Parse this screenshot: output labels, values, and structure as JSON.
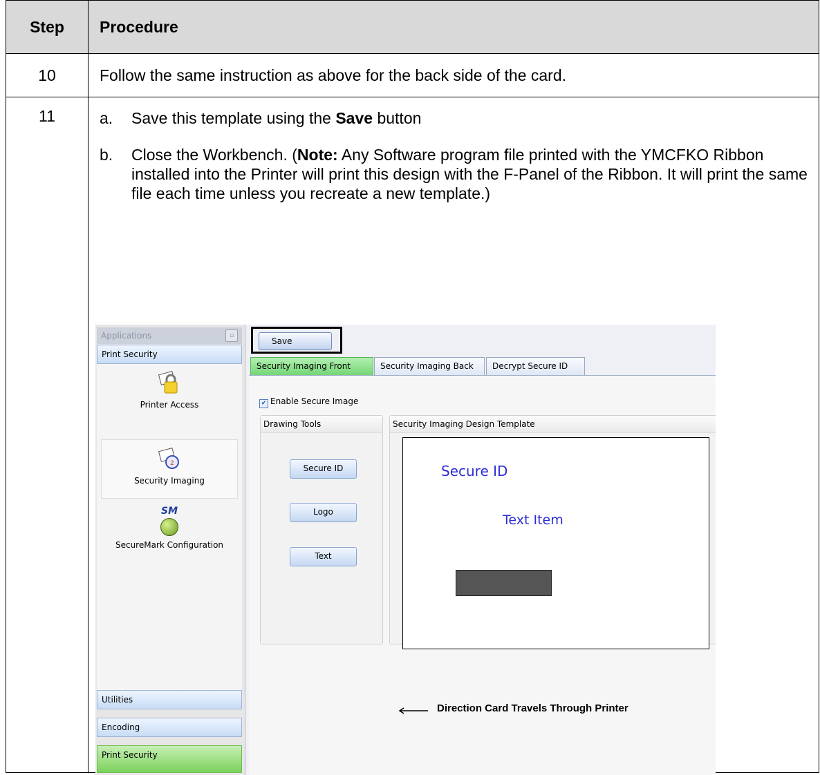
{
  "table": {
    "header": {
      "step": "Step",
      "procedure": "Procedure"
    },
    "row10": {
      "step": "10",
      "text": "Follow the same instruction as above for the back side of the card."
    },
    "row11": {
      "step": "11",
      "item_a": {
        "marker": "a.",
        "before": "Save this template using the ",
        "bold": "Save",
        "after": " button"
      },
      "item_b": {
        "marker": "b.",
        "before": "Close the Workbench. (",
        "bold": "Note:",
        "after": "  Any Software program file printed with the YMCFKO Ribbon installed into the Printer will print this design with the F-Panel of the Ribbon. It will print the same file each time unless you recreate a new template.)"
      }
    }
  },
  "screenshot": {
    "sidebar": {
      "title": "Applications",
      "section": "Print Security",
      "items": [
        "Printer Access",
        "Security Imaging",
        "SecureMark Configuration"
      ],
      "sm_logo": "SM",
      "bottom": [
        "Utilities",
        "Encoding",
        "Print Security"
      ]
    },
    "save_button": "Save",
    "tabs": [
      "Security Imaging Front",
      "Security Imaging Back",
      "Decrypt Secure ID"
    ],
    "enable_checkbox": "Enable Secure Image",
    "drawing_tools": {
      "title": "Drawing Tools",
      "buttons": [
        "Secure ID",
        "Logo",
        "Text"
      ]
    },
    "design_template": {
      "title": "Security Imaging Design Template",
      "secure_id": "Secure ID",
      "text_item": "Text Item"
    },
    "direction_label": "Direction Card Travels Through Printer"
  },
  "colors": {
    "header_bg": "#d9d9d9",
    "active_tab": "#74d674",
    "canvas_text": "#2d2dd6"
  }
}
